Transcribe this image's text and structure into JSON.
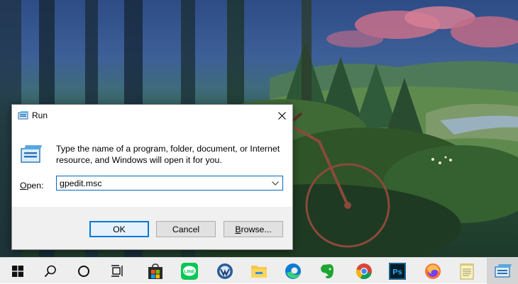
{
  "dialog": {
    "title": "Run",
    "description": "Type the name of a program, folder, document, or Internet resource, and Windows will open it for you.",
    "open_label_first": "O",
    "open_label_rest": "pen:",
    "input_value": "gpedit.msc",
    "ok_label": "OK",
    "cancel_label": "Cancel",
    "browse_label_first": "B",
    "browse_label_rest": "rowse..."
  },
  "taskbar": {
    "icons": [
      "windows-start-icon",
      "search-icon",
      "cortana-icon",
      "task-view-icon",
      "microsoft-store-icon",
      "line-app-icon",
      "app-icon",
      "file-explorer-icon",
      "edge-browser-icon",
      "evernote-icon",
      "chrome-icon",
      "photoshop-icon",
      "firefox-icon",
      "notepad-icon",
      "run-icon"
    ],
    "line_text": "LINE",
    "ps_text": "Ps"
  },
  "colors": {
    "accent": "#0078d7",
    "taskbar": "#eeeeee",
    "button_strip": "#f0f0f0"
  }
}
